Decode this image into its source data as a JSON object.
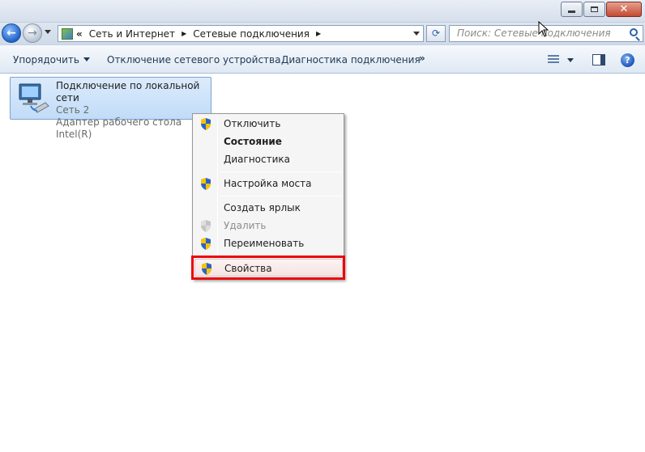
{
  "address_bar": {
    "breadcrumbs": [
      "Сеть и Интернет",
      "Сетевые подключения"
    ],
    "search_placeholder": "Поиск: Сетевые подключения"
  },
  "toolbar": {
    "organize": "Упорядочить",
    "disable_device": "Отключение сетевого устройства",
    "diagnose": "Диагностика подключения",
    "more": "»"
  },
  "connection": {
    "title": "Подключение по локальной сети",
    "network": "Сеть  2",
    "adapter": "Адаптер рабочего стола Intel(R)"
  },
  "context_menu": {
    "items": [
      {
        "label": "Отключить",
        "icon": "shield-icon"
      },
      {
        "label": "Состояние",
        "bold": true
      },
      {
        "label": "Диагностика"
      },
      {
        "label": "Настройка моста",
        "icon": "shield-icon"
      },
      {
        "label": "Создать ярлык"
      },
      {
        "label": "Удалить",
        "icon": "shield-icon",
        "disabled": true
      },
      {
        "label": "Переименовать",
        "icon": "shield-icon"
      },
      {
        "label": "Свойства",
        "icon": "shield-icon",
        "highlighted": true
      }
    ]
  },
  "colors": {
    "highlight_border": "#e8070d",
    "selection": "#c1dcf8"
  }
}
